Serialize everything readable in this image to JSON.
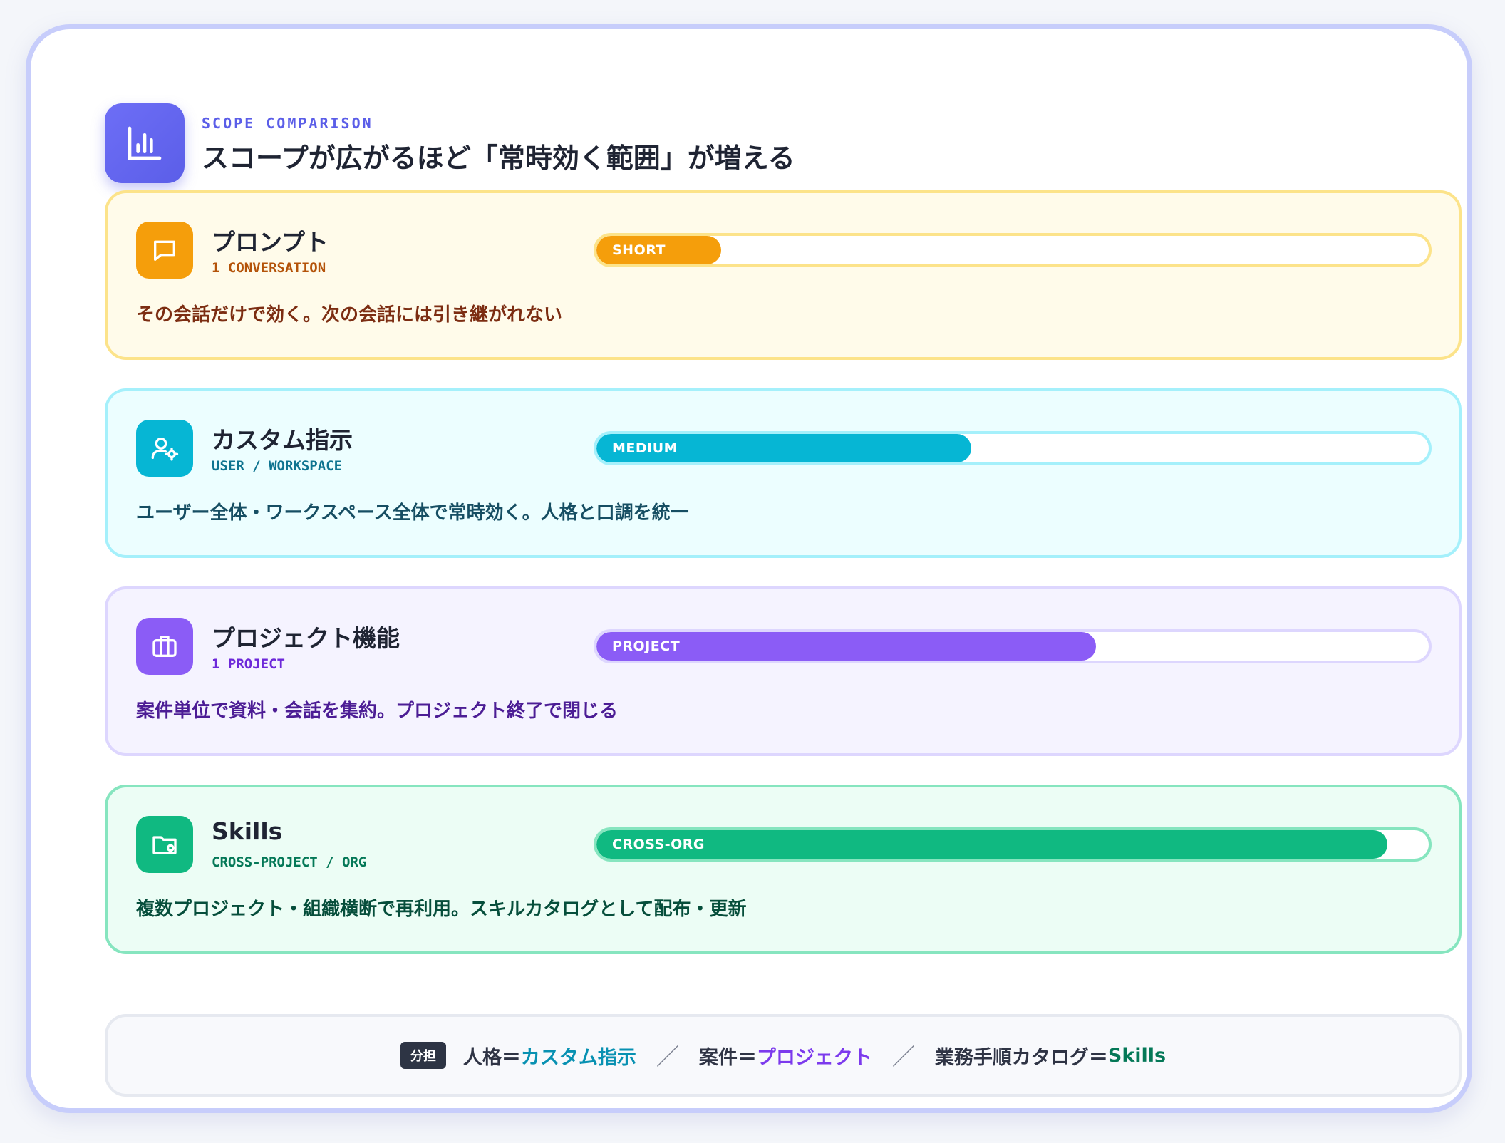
{
  "header": {
    "eyebrow": "SCOPE COMPARISON",
    "title": "スコープが広がるほど「常時効く範囲」が増える",
    "icon": "bar-chart-icon"
  },
  "scopes": [
    {
      "name": "プロンプト",
      "sub": "1 CONVERSATION",
      "bar_label": "SHORT",
      "bar_fill_fraction": 0.15,
      "description": "その会話だけで効く。次の会話には引き継がれない",
      "icon": "chat-bubble-icon",
      "accent": "#f59e0b",
      "bg": "#fffbea",
      "border": "#fce38a",
      "sub_color": "#b45309",
      "desc_color": "#7c2d12"
    },
    {
      "name": "カスタム指示",
      "sub": "USER / WORKSPACE",
      "bar_label": "MEDIUM",
      "bar_fill_fraction": 0.45,
      "description": "ユーザー全体・ワークスペース全体で常時効く。人格と口調を統一",
      "icon": "user-settings-icon",
      "accent": "#06b6d4",
      "bg": "#ecfeff",
      "border": "#a5f0fb",
      "sub_color": "#0e7490",
      "desc_color": "#164e63"
    },
    {
      "name": "プロジェクト機能",
      "sub": "1 PROJECT",
      "bar_label": "PROJECT",
      "bar_fill_fraction": 0.6,
      "description": "案件単位で資料・会話を集約。プロジェクト終了で閉じる",
      "icon": "briefcase-icon",
      "accent": "#8b5cf6",
      "bg": "#f5f3ff",
      "border": "#ddd6fe",
      "sub_color": "#6d28d9",
      "desc_color": "#4c1d95"
    },
    {
      "name": "Skills",
      "sub": "CROSS-PROJECT / ORG",
      "bar_label": "CROSS-ORG",
      "bar_fill_fraction": 0.95,
      "description": "複数プロジェクト・組織横断で再利用。スキルカタログとして配布・更新",
      "icon": "folder-settings-icon",
      "accent": "#10b981",
      "bg": "#ecfdf5",
      "border": "#86e5bf",
      "sub_color": "#047857",
      "desc_color": "#064e3b"
    }
  ],
  "footer": {
    "badge": "分担",
    "item1_prefix": "人格＝",
    "item1_value": "カスタム指示",
    "item1_color": "#0891b2",
    "separator": "／",
    "item2_prefix": "案件＝",
    "item2_value": "プロジェクト",
    "item2_color": "#7c3aed",
    "item3_prefix": "業務手順カタログ＝",
    "item3_value": "Skills",
    "item3_color": "#047857"
  }
}
